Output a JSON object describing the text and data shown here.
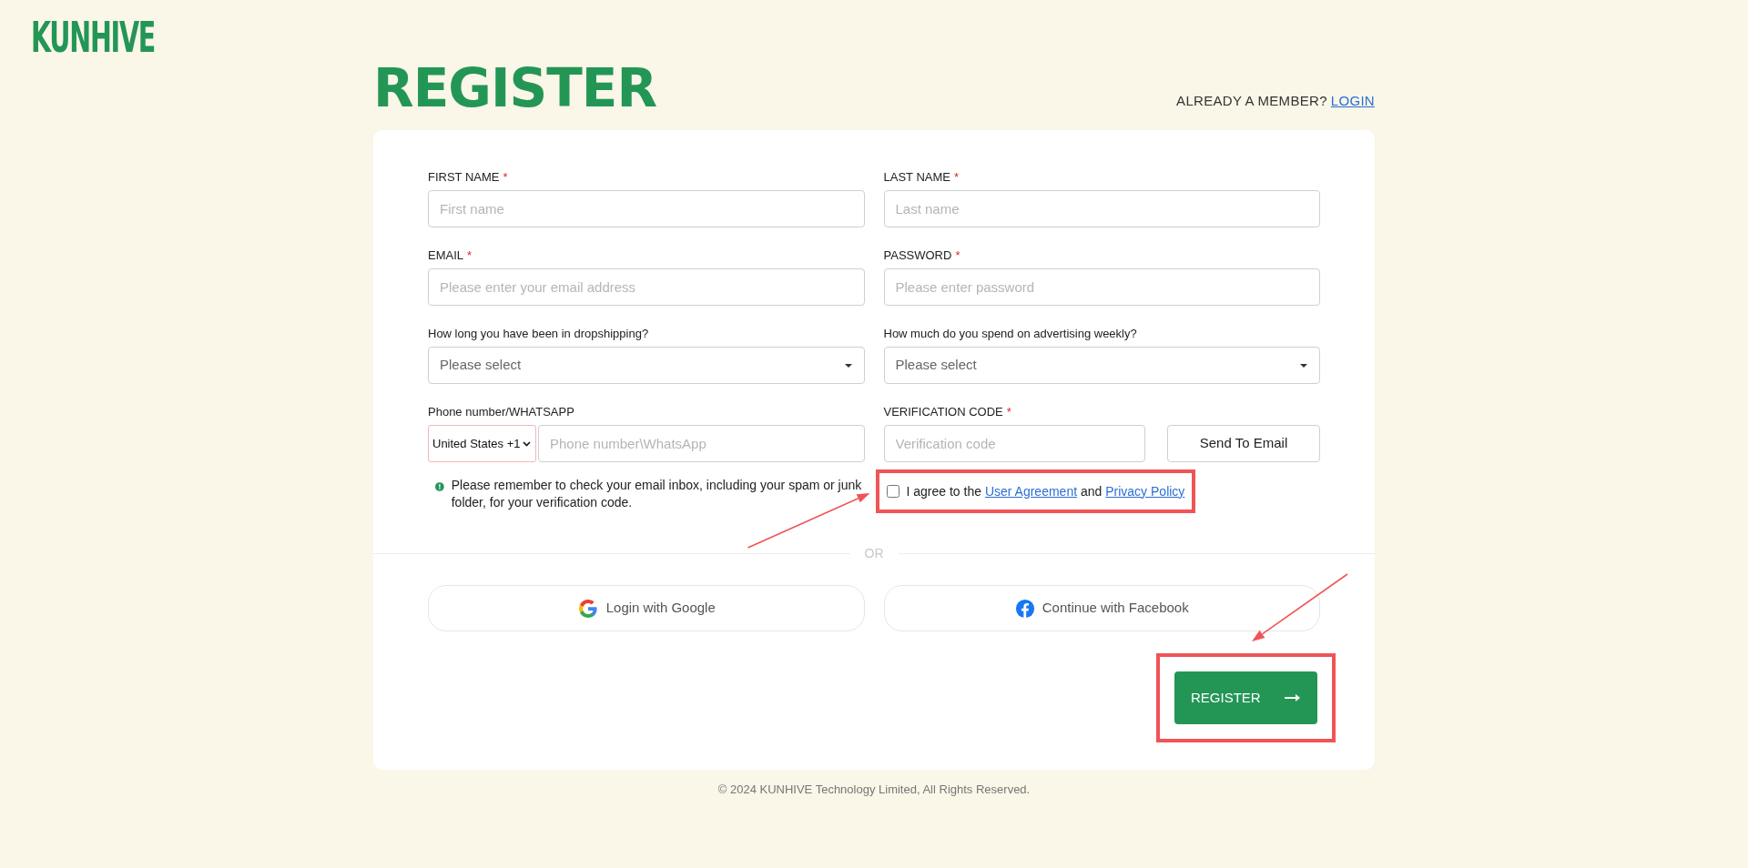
{
  "logo": "KUNHIVE",
  "title": "REGISTER",
  "member_prompt": {
    "text": "ALREADY A MEMBER?",
    "link": "LOGIN"
  },
  "required_mark": "*",
  "fields": [
    {
      "kind": "input",
      "label": "FIRST NAME",
      "required": true,
      "placeholder": "First name"
    },
    {
      "kind": "input",
      "label": "LAST NAME",
      "required": true,
      "placeholder": "Last name"
    },
    {
      "kind": "input",
      "label": "EMAIL",
      "required": true,
      "placeholder": "Please enter your email address"
    },
    {
      "kind": "input",
      "label": "PASSWORD",
      "required": true,
      "placeholder": "Please enter password"
    },
    {
      "kind": "select",
      "label": "How long you have been in dropshipping?",
      "required": false,
      "value": "Please select"
    },
    {
      "kind": "select",
      "label": "How much do you spend on advertising weekly?",
      "required": false,
      "value": "Please select"
    },
    {
      "kind": "phone",
      "label": "Phone number/WHATSAPP",
      "required": false,
      "country": "United States +1",
      "placeholder": "Phone number\\WhatsApp"
    },
    {
      "kind": "code",
      "label": "VERIFICATION CODE",
      "required": true,
      "placeholder": "Verification code",
      "button": "Send To Email"
    }
  ],
  "notice": "Please remember to check your email inbox, including your spam or junk folder, for your verification code.",
  "agreement": {
    "checked": false,
    "highlighted": true,
    "prefix": "I agree to the",
    "link_1": "User Agreement",
    "middle": "and",
    "link_2": "Privacy Policy"
  },
  "divider": "OR",
  "social": [
    {
      "kind": "google",
      "label": "Login with Google"
    },
    {
      "kind": "facebook",
      "label": "Continue with Facebook"
    }
  ],
  "submit": {
    "label": "REGISTER",
    "highlighted": true
  },
  "footer": "© 2024 KUNHIVE Technology Limited, All Rights Reserved."
}
